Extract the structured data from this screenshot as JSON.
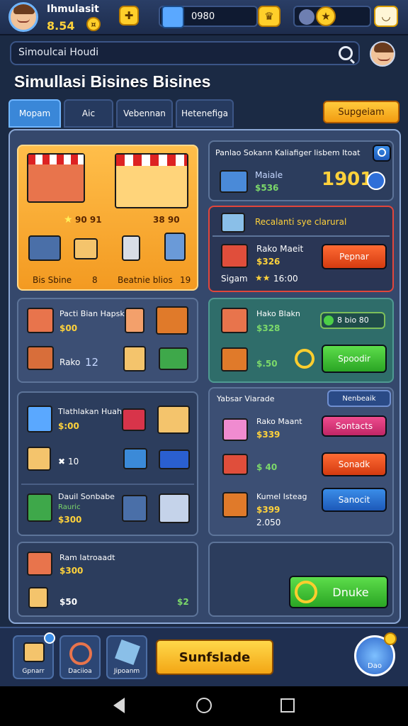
{
  "header": {
    "player_name": "Ihmulasit",
    "money": "8.54",
    "gems": "0980"
  },
  "search": {
    "value": "Simoulcai Houdi"
  },
  "page": {
    "title": "Simullasi Bisines Bisines"
  },
  "tabs": [
    {
      "label": "Mopam"
    },
    {
      "label": "Aic"
    },
    {
      "label": "Vebennan"
    },
    {
      "label": "Hetenefiga"
    }
  ],
  "support_button": "Supgeiam",
  "shop_panel": {
    "stat_left": "90 91",
    "stat_right": "38 90",
    "item_left": "Bis Sbine",
    "item_right": "Beatnie blios",
    "item_left_count": "8",
    "item_right_count": "19"
  },
  "info_panel": {
    "header": "Panlao Sokann Kaliafiger lisbem Itoat",
    "item_name": "Maiale",
    "item_price": "$536",
    "big_number": "1901"
  },
  "special_panel": {
    "header": "Recalanti sye clarural",
    "item_name": "Rako Maeit",
    "item_price": "$326",
    "extra_label": "Sigam",
    "stars": "16:00",
    "button": "Pepnar"
  },
  "mid_left_panel": {
    "title": "Pacti Bian Hapsk",
    "price": "$00",
    "item_name": "Rako",
    "count": "12"
  },
  "mid_right_panel": {
    "title": "Hako Blakn",
    "price": "$328",
    "price2": "$.50",
    "badge": "8 bio 80",
    "button": "Spoodir"
  },
  "lower_left_panel": {
    "row1_title": "Tlathlakan Huahs",
    "row1_price": "$:00",
    "row2_count": "10",
    "row3_title": "Dauil Sonbabe",
    "row3_sub": "Rauric",
    "row3_price": "$300"
  },
  "lower_right_panel": {
    "header": "Yabsar Viarade",
    "header_button": "Nenbeaik",
    "rows": [
      {
        "name": "Rako Maant",
        "price": "$339",
        "button": "Sontacts"
      },
      {
        "name": "",
        "price": "$ 40",
        "button": "Sonadk"
      },
      {
        "name": "Kumel Isteag",
        "price": "$399",
        "extra": "2.050",
        "button": "Sanocit"
      }
    ]
  },
  "bottom_left_panel": {
    "title": "Ram Iatroaadt",
    "price": "$300",
    "price2": "$50",
    "count": "$2"
  },
  "bottom_right_panel": {
    "button": "Dnuke"
  },
  "bottom_nav": [
    {
      "label": "Gpnarr"
    },
    {
      "label": "Daciioa"
    },
    {
      "label": "Jipoanm"
    }
  ],
  "main_action": "Sunfslade",
  "corner_button": "Dao",
  "colors": {
    "accent_yellow": "#ffcf2a",
    "primary_blue": "#3a87d8",
    "panel_bg": "#2c3d5d"
  }
}
